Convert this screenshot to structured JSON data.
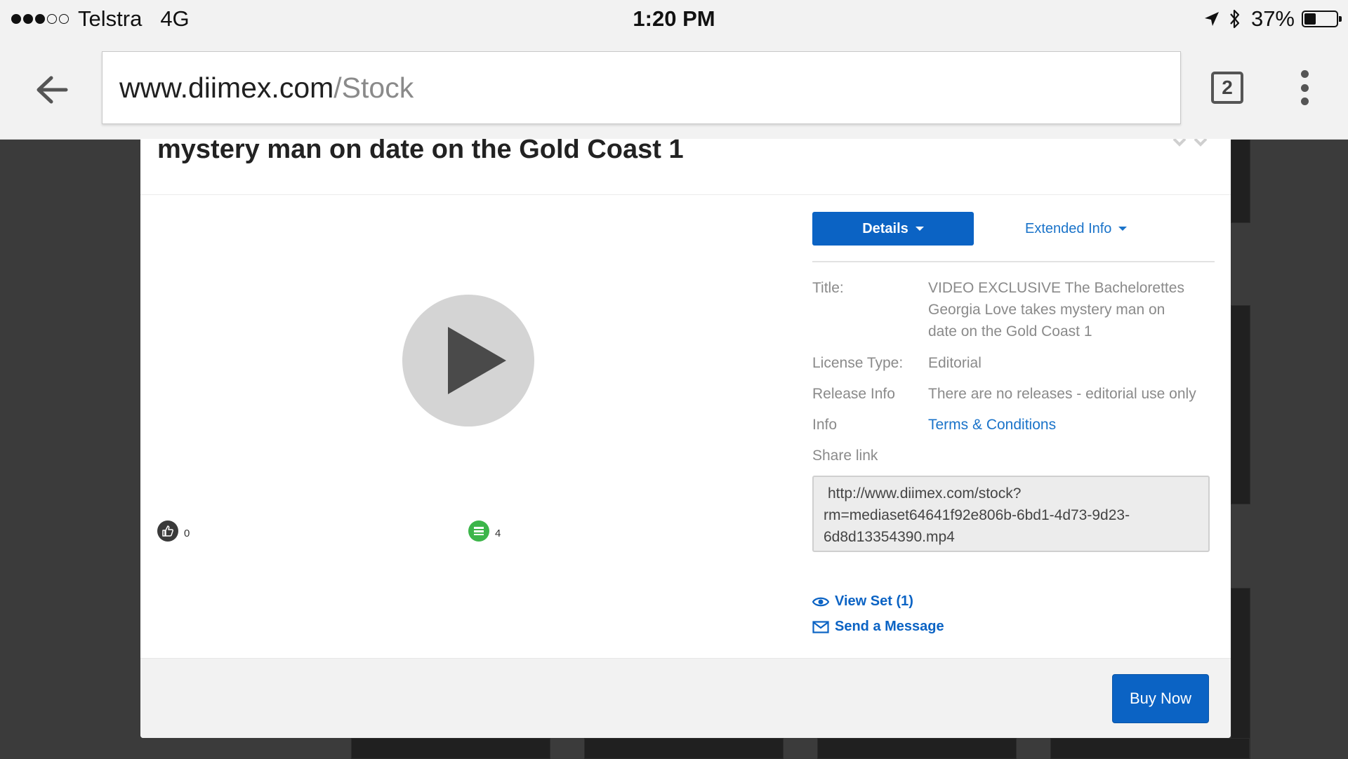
{
  "status_bar": {
    "carrier": "Telstra",
    "network": "4G",
    "time": "1:20 PM",
    "battery_percent": "37%",
    "signal_bars_filled": 3,
    "signal_bars_total": 5,
    "battery_level": 0.37
  },
  "browser": {
    "url_domain": "www.diimex.com",
    "url_path": "/Stock",
    "tab_count": "2"
  },
  "modal": {
    "title": "mystery man on date on the Gold Coast 1",
    "likes_count": "0",
    "sets_count": "4",
    "details_tab_label": "Details",
    "extended_tab_label": "Extended Info",
    "details": {
      "title_label": "Title:",
      "title_value_lines": [
        "VIDEO EXCLUSIVE The Bachelorettes",
        "Georgia Love takes mystery man on",
        "date on the Gold Coast 1"
      ],
      "license_label": "License Type:",
      "license_value": "Editorial",
      "release_label": "Release Info",
      "release_value": "There are no releases - editorial use only",
      "info_label": "Info",
      "info_link": "Terms & Conditions",
      "share_label": "Share link",
      "share_link_lines": [
        "http://www.diimex.com/stock?",
        "rm=mediaset64641f92e806b-6bd1-4d73-9d23-",
        "6d8d13354390.mp4"
      ]
    },
    "view_set_label": "View Set (1)",
    "send_message_label": "Send a Message",
    "buy_now_label": "Buy Now"
  },
  "colors": {
    "accent_blue": "#0b63c4",
    "link_blue": "#1a73c9",
    "sets_icon_green": "#3cb54a"
  }
}
